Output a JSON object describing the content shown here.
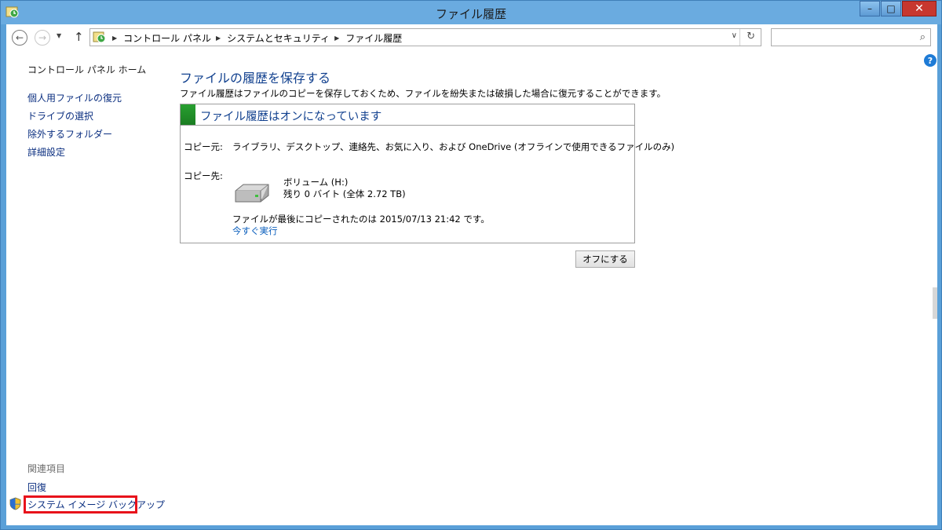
{
  "window": {
    "title": "ファイル履歴",
    "buttons": {
      "minimize": "–",
      "maximize": "□",
      "close": "✕"
    }
  },
  "address_bar": {
    "back_icon": "back-arrow-icon",
    "forward_icon": "forward-arrow-icon",
    "breadcrumbs": [
      "コントロール パネル",
      "システムとセキュリティ",
      "ファイル履歴"
    ],
    "search_placeholder": ""
  },
  "sidebar": {
    "home_label": "コントロール パネル ホーム",
    "links": [
      "個人用ファイルの復元",
      "ドライブの選択",
      "除外するフォルダー",
      "詳細設定"
    ],
    "related_heading": "関連項目",
    "related_links": [
      "回復",
      "システム イメージ バックアップ"
    ]
  },
  "main": {
    "heading": "ファイルの履歴を保存する",
    "description": "ファイル履歴はファイルのコピーを保存しておくため、ファイルを紛失または破損した場合に復元することができます。",
    "status": "ファイル履歴はオンになっています",
    "status_color": "#1f8a27",
    "copy_source_label": "コピー元:",
    "copy_source_value": "ライブラリ、デスクトップ、連絡先、お気に入り、および OneDrive (オフラインで使用できるファイルのみ)",
    "copy_dest_label": "コピー先:",
    "drive_name": "ボリューム (H:)",
    "drive_space": "残り 0 バイト (全体 2.72 TB)",
    "last_copied": "ファイルが最後にコピーされたのは 2015/07/13 21:42 です。",
    "run_now": "今すぐ実行",
    "off_button": "オフにする"
  },
  "colors": {
    "link": "#0b2f80",
    "heading": "#12418f",
    "highlight_border": "#e8121b"
  }
}
